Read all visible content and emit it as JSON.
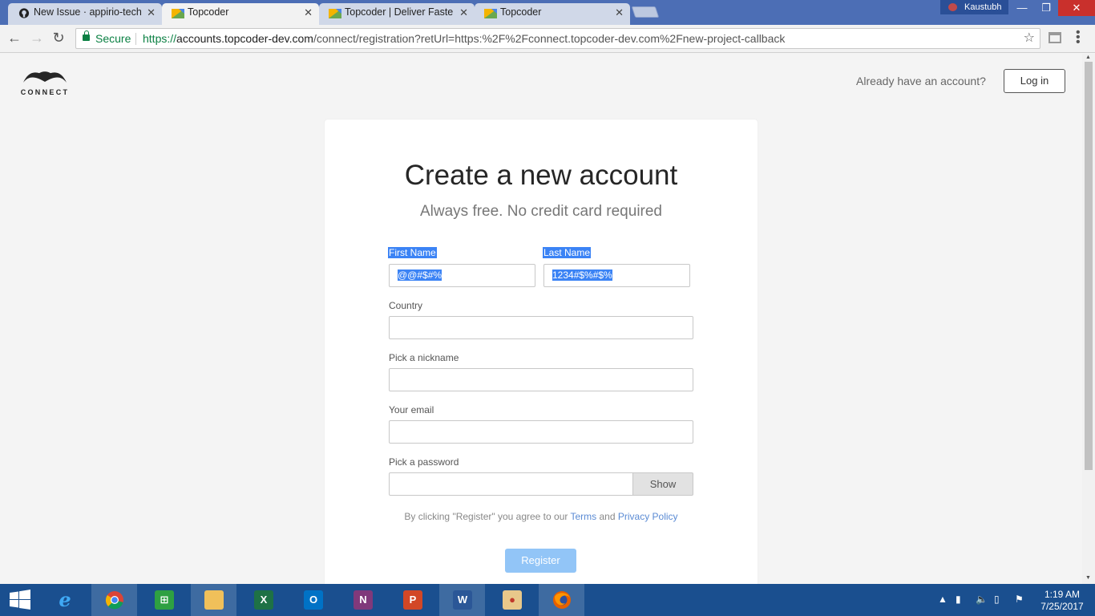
{
  "browser": {
    "tabs": [
      {
        "title": "New Issue · appirio-tech/",
        "icon": "github-icon",
        "active": false
      },
      {
        "title": "Topcoder",
        "icon": "topcoder-icon",
        "active": true
      },
      {
        "title": "Topcoder | Deliver Faster",
        "icon": "topcoder-icon",
        "active": false
      },
      {
        "title": "Topcoder",
        "icon": "topcoder-icon",
        "active": false
      }
    ],
    "close_glyph": "✕",
    "profile_name": "Kaustubh",
    "secure_label": "Secure",
    "url_scheme": "https://",
    "url_host": "accounts.topcoder-dev.com",
    "url_rest": "/connect/registration?retUrl=https:%2F%2Fconnect.topcoder-dev.com%2Fnew-project-callback"
  },
  "header": {
    "logo_text": "CONNECT",
    "already_text": "Already have an account?",
    "login_label": "Log in"
  },
  "form": {
    "title": "Create a new account",
    "subtitle": "Always free. No credit card required",
    "first_name_label": "First Name",
    "first_name_value": "@@#$#%",
    "last_name_label": "Last Name",
    "last_name_value": "1234#$%#$%",
    "country_label": "Country",
    "nickname_label": "Pick a nickname",
    "email_label": "Your email",
    "password_label": "Pick a password",
    "show_label": "Show",
    "terms_prefix": "By clicking \"Register\" you agree to our ",
    "terms_link": "Terms",
    "terms_and": " and ",
    "privacy_link": "Privacy Policy",
    "register_label": "Register"
  },
  "taskbar": {
    "time": "1:19 AM",
    "date": "7/25/2017"
  },
  "colors": {
    "accent": "#5b8bd4",
    "register_disabled": "#92c5f7",
    "selection": "#3b83f5",
    "secure": "#0b8043"
  }
}
